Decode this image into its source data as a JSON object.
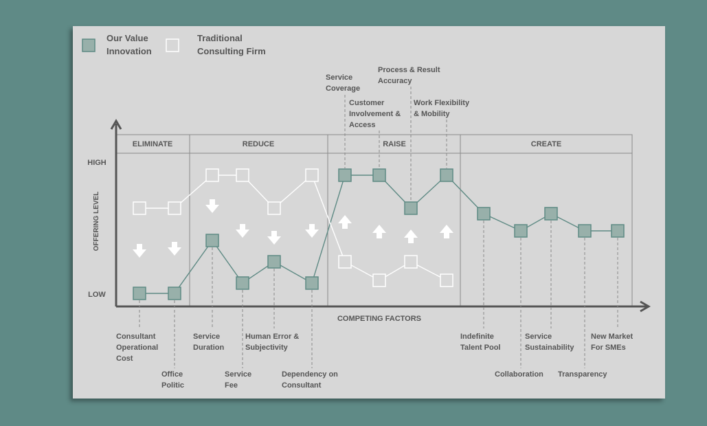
{
  "colors": {
    "background": "#5f8a86",
    "panel": "#d7d7d7",
    "value_line": "#5e8a84",
    "traditional_line": "#ffffff",
    "marker_value_fill": "#98b0aa",
    "text": "#555555"
  },
  "legend": [
    {
      "label": [
        "Our Value",
        "Innovation"
      ],
      "swatch": "value"
    },
    {
      "label": [
        "Traditional",
        "Consulting Firm"
      ],
      "swatch": "traditional"
    }
  ],
  "axes": {
    "y_label": "OFFERING LEVEL",
    "y_high": "HIGH",
    "y_low": "LOW",
    "x_label": "COMPETING  FACTORS"
  },
  "sections": [
    "ELIMINATE",
    "REDUCE",
    "RAISE",
    "CREATE"
  ],
  "factors": [
    {
      "label": [
        "Consultant",
        "Operational",
        "Cost"
      ],
      "section": "ELIMINATE",
      "value": "low",
      "traditional": "mid",
      "arrow": "down"
    },
    {
      "label": [
        "Office",
        "Politic"
      ],
      "section": "ELIMINATE",
      "value": "low",
      "traditional": "mid",
      "arrow": "down"
    },
    {
      "label": [
        "Service",
        "Duration"
      ],
      "section": "REDUCE",
      "value": "mid",
      "traditional": "high",
      "arrow": "down"
    },
    {
      "label": [
        "Service",
        "Fee"
      ],
      "section": "REDUCE",
      "value": "low-mid",
      "traditional": "high",
      "arrow": "down"
    },
    {
      "label": [
        "Human Error &",
        "Subjectivity"
      ],
      "section": "REDUCE",
      "value": "low-mid",
      "traditional": "mid",
      "arrow": "down"
    },
    {
      "label": [
        "Dependency on",
        "Consultant"
      ],
      "section": "REDUCE",
      "value": "low-mid",
      "traditional": "high",
      "arrow": "down"
    },
    {
      "label": [
        "Service",
        "Coverage"
      ],
      "section": "RAISE",
      "value": "high",
      "traditional": "low-mid",
      "arrow": "up"
    },
    {
      "label": [
        "Customer",
        "Involvement &",
        "Access"
      ],
      "section": "RAISE",
      "value": "high",
      "traditional": "low-mid",
      "arrow": "up"
    },
    {
      "label": [
        "Process & Result",
        "Accuracy"
      ],
      "section": "RAISE",
      "value": "mid",
      "traditional": "low-mid",
      "arrow": "up"
    },
    {
      "label": [
        "Work Flexibility",
        "& Mobility"
      ],
      "section": "RAISE",
      "value": "high",
      "traditional": "low-mid",
      "arrow": "up"
    },
    {
      "label": [
        "Indefinite",
        "Talent Pool"
      ],
      "section": "CREATE",
      "value": "mid",
      "traditional": null,
      "arrow": null
    },
    {
      "label": [
        "Collaboration"
      ],
      "section": "CREATE",
      "value": "mid",
      "traditional": null,
      "arrow": null
    },
    {
      "label": [
        "Service",
        "Sustainability"
      ],
      "section": "CREATE",
      "value": "mid",
      "traditional": null,
      "arrow": null
    },
    {
      "label": [
        "Transparency"
      ],
      "section": "CREATE",
      "value": "mid",
      "traditional": null,
      "arrow": null
    },
    {
      "label": [
        "New Market",
        "For SMEs"
      ],
      "section": "CREATE",
      "value": "mid",
      "traditional": null,
      "arrow": null
    }
  ]
}
